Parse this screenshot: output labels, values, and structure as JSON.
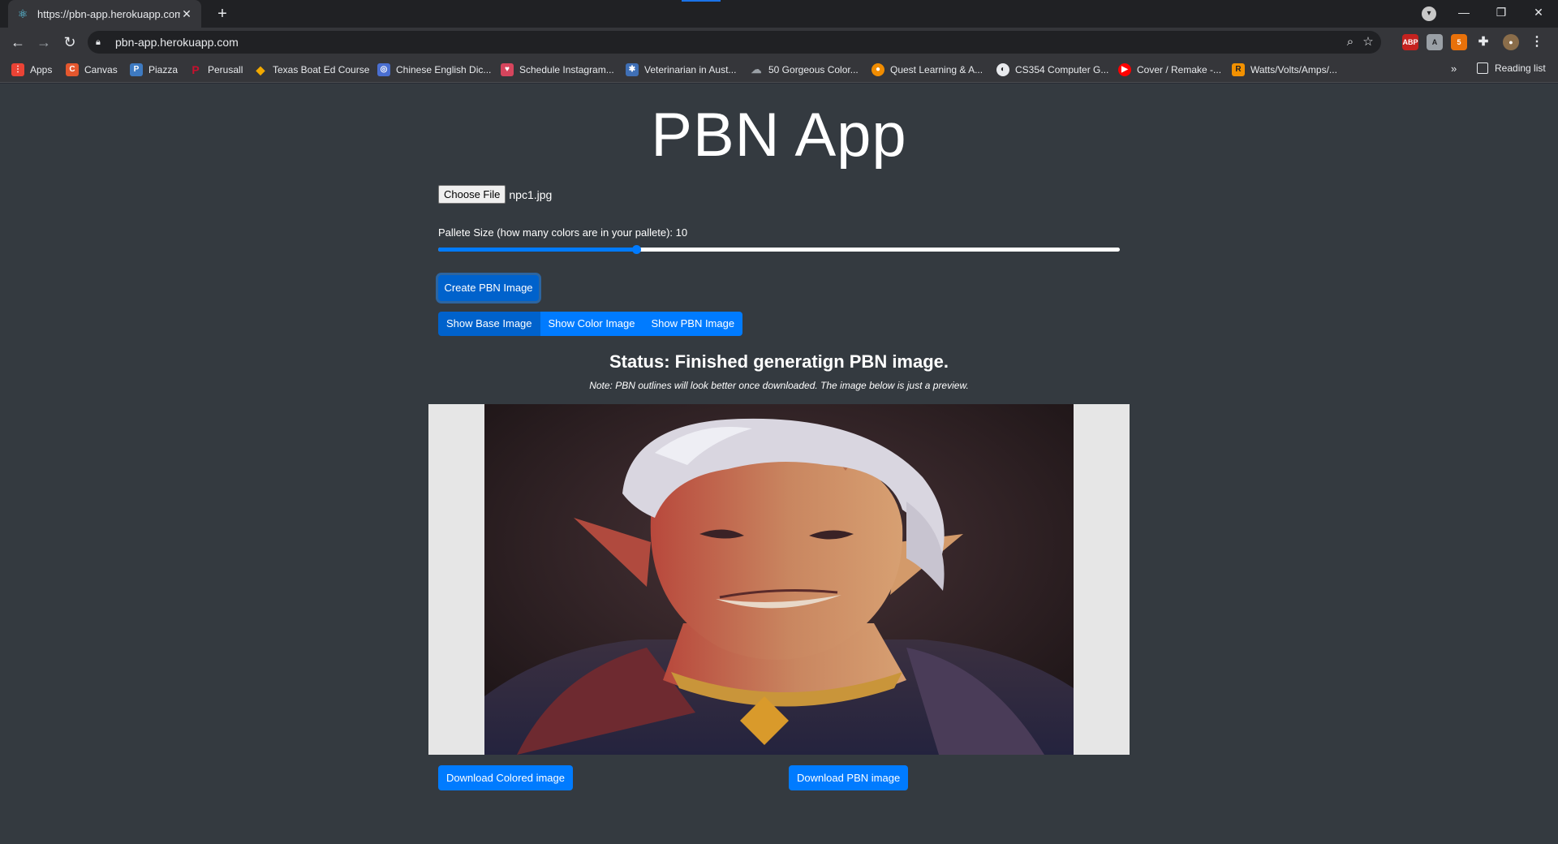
{
  "browser": {
    "tab_title": "https://pbn-app.herokuapp.com",
    "url": "pbn-app.herokuapp.com",
    "bookmarks": [
      {
        "label": "Apps",
        "icon": "apps-grid-icon",
        "color": "#ea4335"
      },
      {
        "label": "Canvas",
        "icon": "canvas-icon",
        "color": "#e4572e"
      },
      {
        "label": "Piazza",
        "icon": "piazza-icon",
        "color": "#3e7ac1"
      },
      {
        "label": "Perusall",
        "icon": "perusall-icon",
        "color": "#c8102e"
      },
      {
        "label": "Texas Boat Ed Course",
        "icon": "boat-ed-icon",
        "color": "#f2a900"
      },
      {
        "label": "Chinese English Dic...",
        "icon": "dictionary-icon",
        "color": "#4a6fd1"
      },
      {
        "label": "Schedule Instagram...",
        "icon": "schedule-icon",
        "color": "#d6455d"
      },
      {
        "label": "Veterinarian in Aust...",
        "icon": "vet-icon",
        "color": "#3f6fb5"
      },
      {
        "label": "50 Gorgeous Color...",
        "icon": "color-icon",
        "color": "#9aa0a6"
      },
      {
        "label": "Quest Learning & A...",
        "icon": "quest-icon",
        "color": "#f08c00"
      },
      {
        "label": "CS354 Computer G...",
        "icon": "globe-icon",
        "color": "#e8eaed"
      },
      {
        "label": "Cover / Remake -...",
        "icon": "youtube-icon",
        "color": "#ff0000"
      },
      {
        "label": "Watts/Volts/Amps/...",
        "icon": "r-icon",
        "color": "#f29100"
      }
    ],
    "reading_list": "Reading list",
    "more_bookmarks": "»"
  },
  "app": {
    "title": "PBN App",
    "choose_file_label": "Choose File",
    "file_name": "npc1.jpg",
    "palette_label": "Pallete Size (how many colors are in your pallete): 10",
    "palette_size": 10,
    "palette_fraction": 0.29,
    "create_button": "Create PBN Image",
    "view_buttons": [
      "Show Base Image",
      "Show Color Image",
      "Show PBN Image"
    ],
    "status": "Status: Finished generatign PBN image.",
    "note": "Note: PBN outlines will look better once downloaded. The image below is just a preview.",
    "download_colored": "Download Colored image",
    "download_pbn": "Download PBN image"
  },
  "colors": {
    "primary": "#007bff",
    "page_bg": "#343a40"
  }
}
